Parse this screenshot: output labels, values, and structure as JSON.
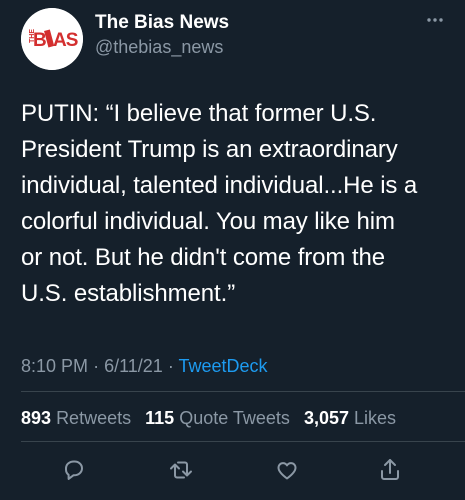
{
  "author": {
    "display_name": "The Bias News",
    "handle": "@thebias_news",
    "avatar_logo_text": "THE BIAS",
    "avatar_icon": "logo-avatar"
  },
  "more_icon": "ellipsis-icon",
  "tweet": {
    "lines": [
      "PUTIN: “I believe that former U.S.",
      "President Trump is an extraordinary",
      "individual, talented individual...He is a",
      "colorful individual. You may like him",
      "or not. But he didn't come from the",
      "U.S. establishment.”"
    ],
    "time": "8:10 PM",
    "date": "6/11/21",
    "separator": "·",
    "source": "TweetDeck"
  },
  "stats": {
    "retweets_count": "893",
    "retweets_label": "Retweets",
    "quotes_count": "115",
    "quotes_label": "Quote Tweets",
    "likes_count": "3,057",
    "likes_label": "Likes"
  },
  "actions": [
    {
      "name": "reply",
      "icon": "comment-icon"
    },
    {
      "name": "retweet",
      "icon": "retweet-icon"
    },
    {
      "name": "like",
      "icon": "heart-icon"
    },
    {
      "name": "share",
      "icon": "share-icon"
    }
  ],
  "colors": {
    "background": "#15202b",
    "text": "#ffffff",
    "secondary": "#8b98a5",
    "accent": "#1d9bf0",
    "divider": "#38444d",
    "logo_red": "#d32f2f"
  }
}
